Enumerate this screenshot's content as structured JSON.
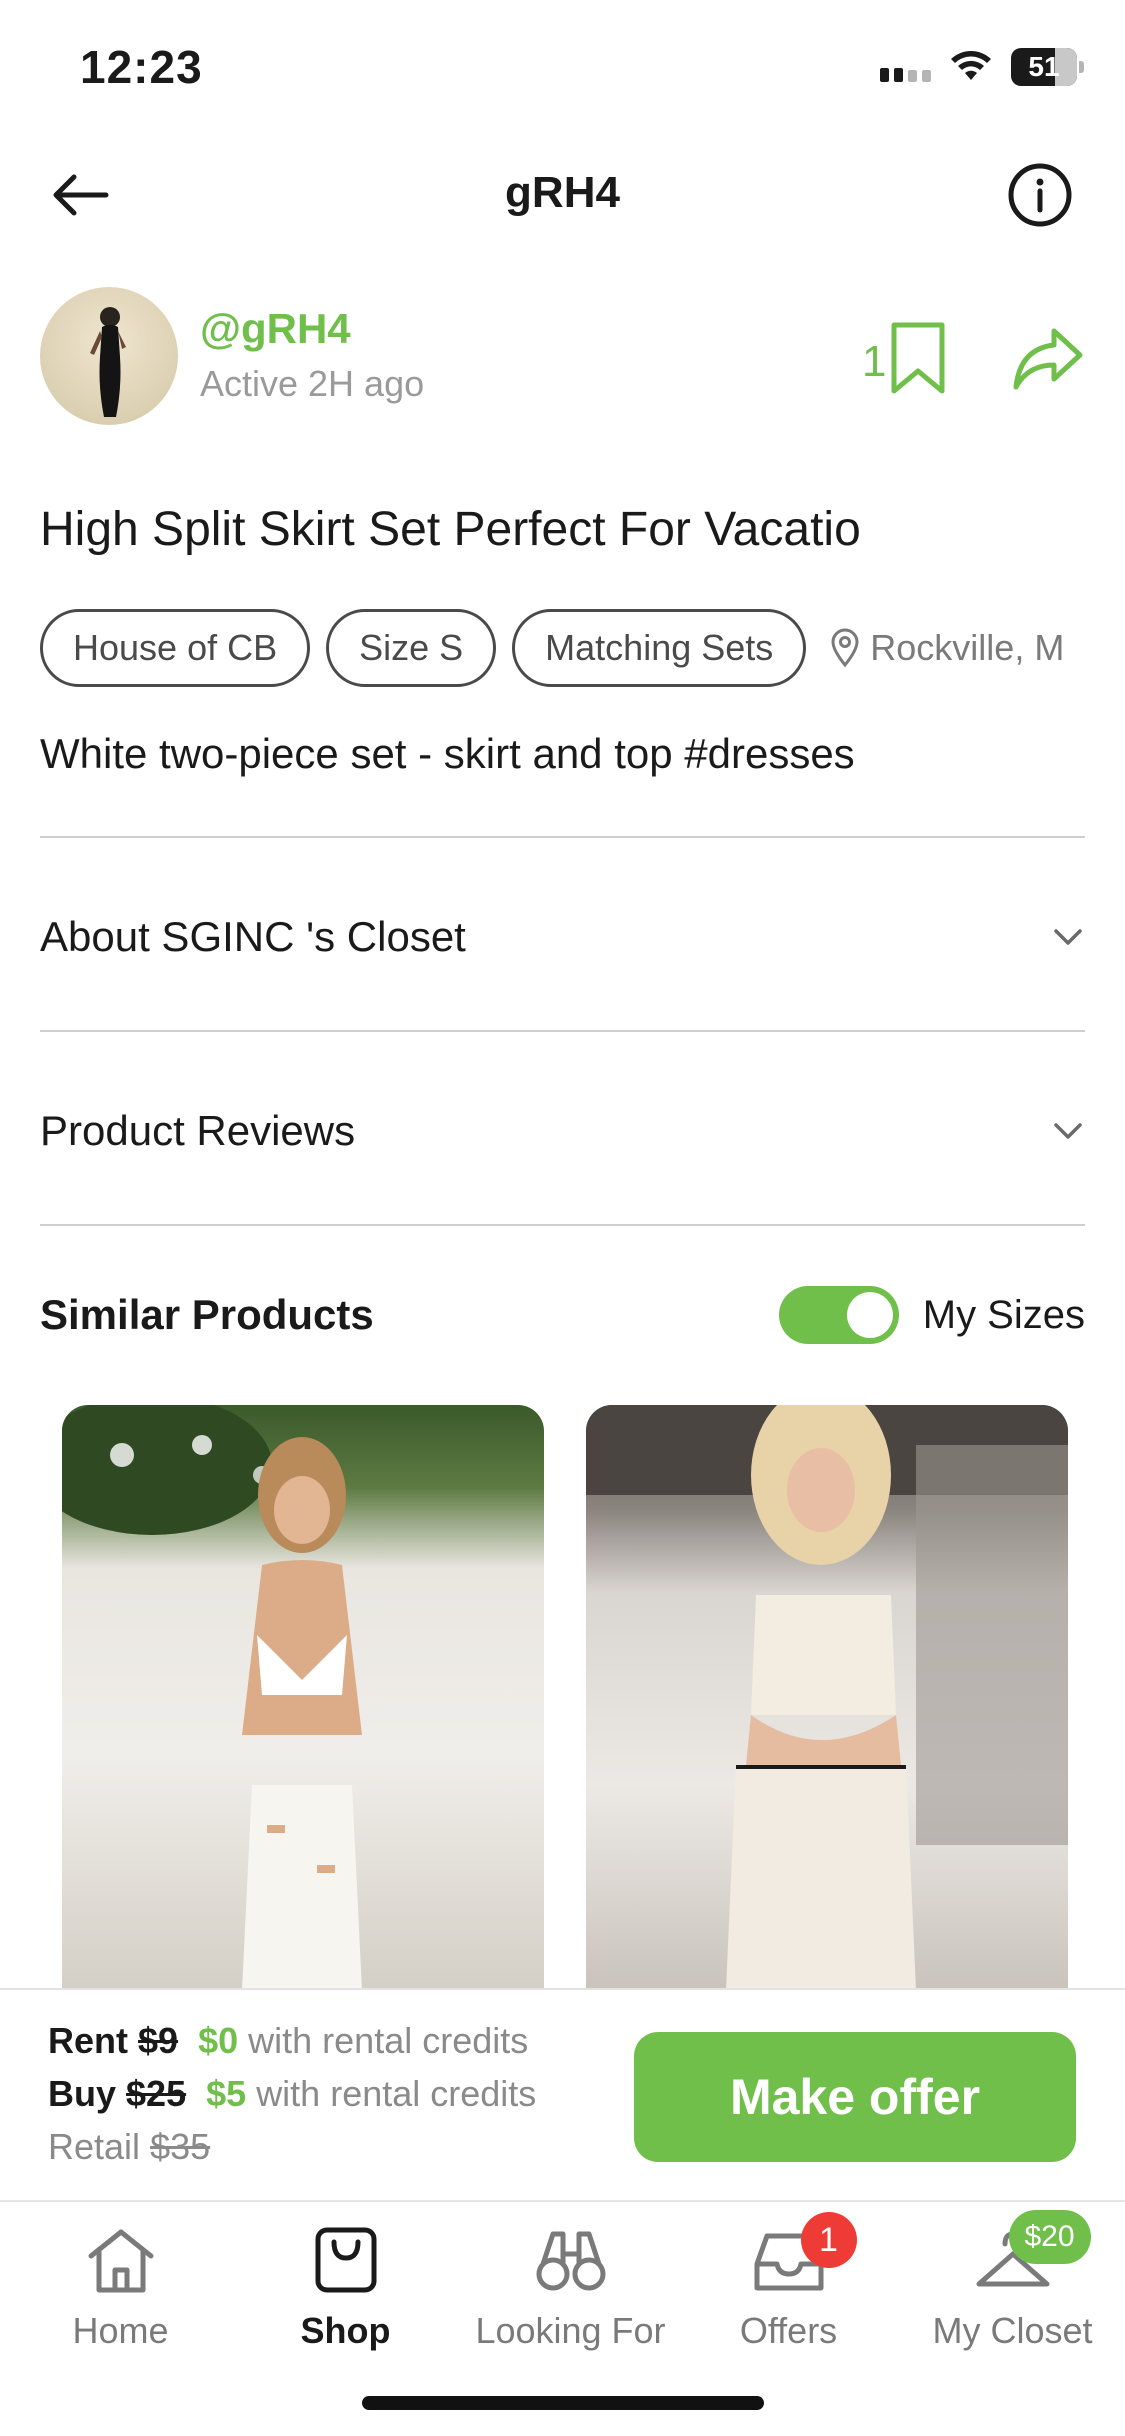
{
  "status_bar": {
    "time": "12:23",
    "battery": "51"
  },
  "header": {
    "title": "gRH4"
  },
  "seller": {
    "handle": "@gRH4",
    "active": "Active 2H ago",
    "save_count": "1"
  },
  "listing": {
    "title": "High Split Skirt Set Perfect For Vacatio",
    "tags": [
      "House of CB",
      "Size S",
      "Matching Sets"
    ],
    "location": "Rockville, M",
    "description": "White two-piece set - skirt and top #dresses"
  },
  "sections": {
    "about": "About SGINC  's Closet",
    "reviews": "Product Reviews",
    "similar": "Similar Products",
    "my_sizes": "My Sizes",
    "my_sizes_on": true
  },
  "pricing": {
    "rent_label": "Rent",
    "rent_price": "$9",
    "rent_credit_price": "$0",
    "rent_credit_text": "with rental credits",
    "buy_label": "Buy",
    "buy_price": "$25",
    "buy_credit_price": "$5",
    "buy_credit_text": "with rental credits",
    "retail_label": "Retail",
    "retail_price": "$35",
    "cta": "Make offer"
  },
  "tabs": [
    {
      "label": "Home",
      "icon": "home-icon"
    },
    {
      "label": "Shop",
      "icon": "shopping-bag-icon",
      "active": true
    },
    {
      "label": "Looking For",
      "icon": "binoculars-icon"
    },
    {
      "label": "Offers",
      "icon": "inbox-icon",
      "badge": "1"
    },
    {
      "label": "My Closet",
      "icon": "hanger-icon",
      "badge": "$20"
    }
  ],
  "colors": {
    "accent": "#6fbf4a",
    "badge_red": "#ef3b36"
  }
}
